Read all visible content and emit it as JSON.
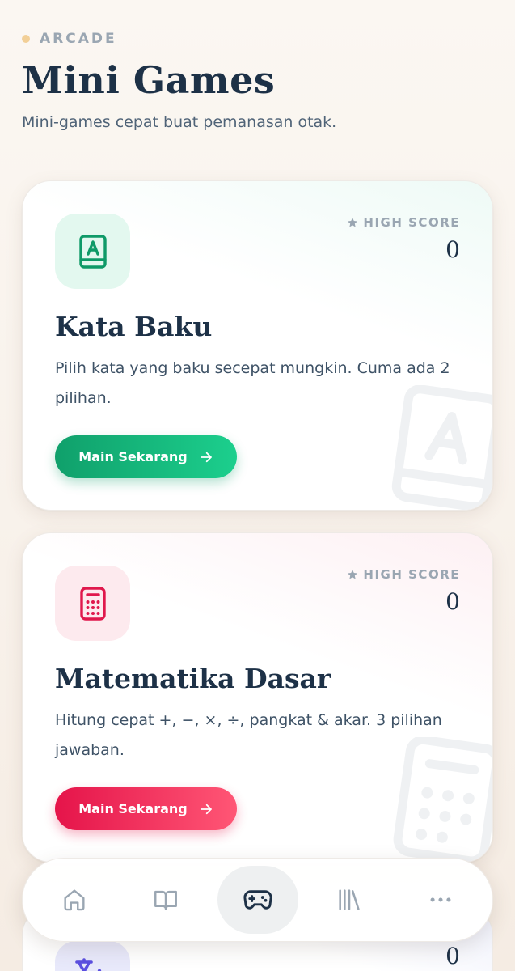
{
  "header": {
    "eyebrow": "ARCADE",
    "title": "Mini Games",
    "subtitle": "Mini-games cepat buat pemanasan otak."
  },
  "colors": {
    "accent_green": "#10a06b",
    "accent_pink": "#e5144a",
    "accent_indigo": "#5b4fe0",
    "eyebrow_dot": "#f2cf97"
  },
  "games": [
    {
      "icon": "book-letter-icon",
      "title": "Kata Baku",
      "description": "Pilih kata yang baku secepat mungkin. Cuma ada 2 pilihan.",
      "highscore_label": "HIGH SCORE",
      "highscore_value": "0",
      "button_label": "Main Sekarang"
    },
    {
      "icon": "calculator-icon",
      "title": "Matematika Dasar",
      "description": "Hitung cepat +, −, ×, ÷, pangkat & akar. 3 pilihan jawaban.",
      "highscore_label": "HIGH SCORE",
      "highscore_value": "0",
      "button_label": "Main Sekarang"
    },
    {
      "icon": "translate-icon",
      "highscore_value": "0"
    }
  ],
  "nav": {
    "items": [
      {
        "icon": "home-icon",
        "active": false
      },
      {
        "icon": "book-open-icon",
        "active": false
      },
      {
        "icon": "gamepad-icon",
        "active": true
      },
      {
        "icon": "library-icon",
        "active": false
      },
      {
        "icon": "more-icon",
        "active": false
      }
    ]
  }
}
